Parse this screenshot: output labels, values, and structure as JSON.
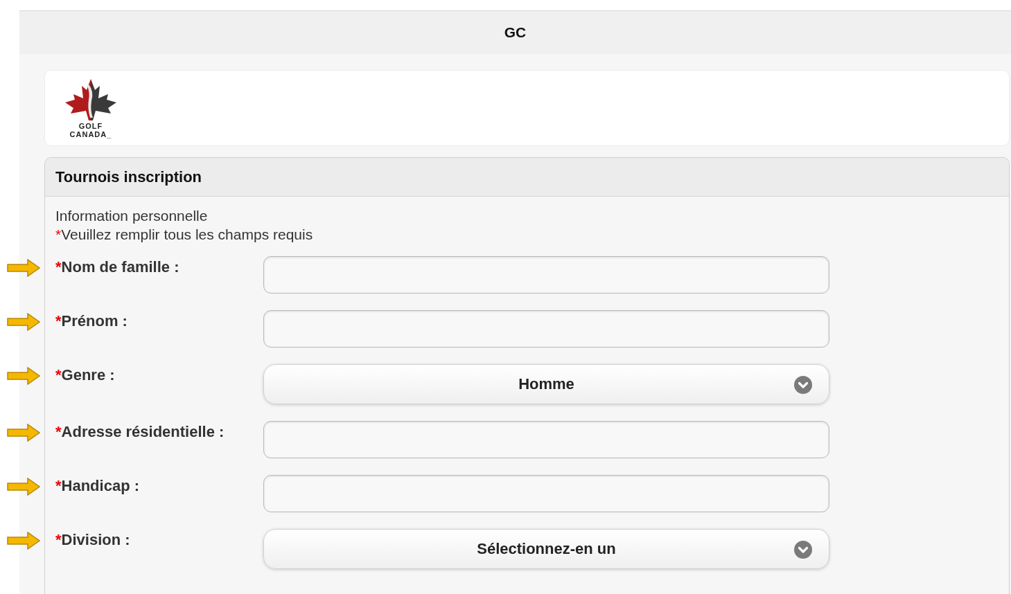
{
  "header": {
    "title": "GC"
  },
  "logo": {
    "lines": [
      "GOLF",
      "CANADA"
    ],
    "suffix": "_"
  },
  "form": {
    "title": "Tournois inscription",
    "section": "Information personnelle",
    "note": {
      "mark": "*",
      "text": "Veuillez remplir tous les champs requis"
    },
    "fields": [
      {
        "kind": "text",
        "mark": "*",
        "label": "Nom de famille :",
        "annotated": true
      },
      {
        "kind": "text",
        "mark": "*",
        "label": "Prénom :",
        "annotated": true
      },
      {
        "kind": "select",
        "mark": "*",
        "label": "Genre :",
        "value": "Homme",
        "annotated": true
      },
      {
        "kind": "text",
        "mark": "*",
        "label": "Adresse résidentielle :",
        "annotated": true
      },
      {
        "kind": "text",
        "mark": "*",
        "label": "Handicap :",
        "annotated": true
      },
      {
        "kind": "select",
        "mark": "*",
        "label": "Division :",
        "value": "Sélectionnez-en un",
        "annotated": true
      }
    ]
  }
}
